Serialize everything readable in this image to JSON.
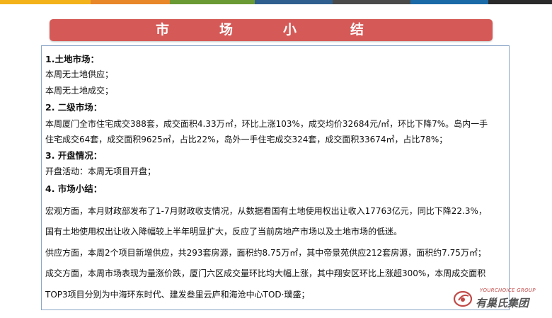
{
  "colors": {
    "topbar": [
      "#f3b21a",
      "#e8862a",
      "#6a9a34",
      "#2f5f8f",
      "#4a4a4a",
      "#1a6aa8",
      "#2a2a2a"
    ],
    "banner": "#d55a57",
    "panel_border": "#8aa6c8"
  },
  "banner": {
    "chars": [
      "市",
      "场",
      "小",
      "结"
    ]
  },
  "content": {
    "land_heading": "1.土地市场：",
    "land_line1": "本周无土地供应；",
    "land_line2": "本周无土地成交；",
    "secondary_heading": "2. 二级市场：",
    "secondary_line1": "本周厦门全市住宅成交388套，成交面积4.33万㎡，环比上涨103%，成交均价32684元/㎡，环比下降7%。岛内一手",
    "secondary_line2": "住宅成交64套，成交面积9625㎡，占比22%，岛外一手住宅成交324套，成交面积33674㎡，占比78%；",
    "opening_heading": "3. 开盘情况：",
    "opening_line1": "开盘活动：本周无项目开盘；",
    "summary_heading": "4. 市场小结：",
    "summary_line1": "宏观方面，本月财政部发布了1-7月财政收支情况，从数据看国有土地使用权出让收入17763亿元，同比下降22.3%，",
    "summary_line2": "国有土地使用权出让收入降幅较上半年明显扩大，反应了当前房地产市场以及土地市场的低迷。",
    "summary_line3": "供应方面，本周2个项目新增供应，共293套房源，面积约8.75万㎡，其中帝景苑供应212套房源，面积约7.75万㎡；",
    "summary_line4": "成交方面，本周市场表现为量涨价跌，厦门六区成交量环比均大幅上涨，其中翔安区环比上涨超300%，本周成交面积",
    "summary_line5": "TOP3项目分别为中海环东时代、建发叁里云庐和海沧中心TOD·璞盛；"
  },
  "logo": {
    "sub": "YOURCHOICE GROUP",
    "name": "有巢氏集团"
  }
}
